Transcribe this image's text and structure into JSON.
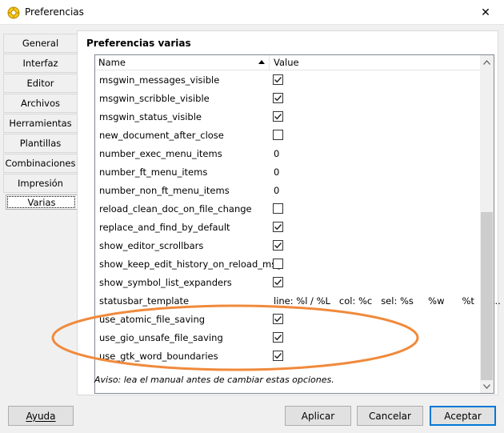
{
  "window": {
    "title": "Preferencias",
    "close_glyph": "✕"
  },
  "tabs": [
    {
      "label": "General",
      "active": false
    },
    {
      "label": "Interfaz",
      "active": false
    },
    {
      "label": "Editor",
      "active": false
    },
    {
      "label": "Archivos",
      "active": false
    },
    {
      "label": "Herramientas",
      "active": false
    },
    {
      "label": "Plantillas",
      "active": false
    },
    {
      "label": "Combinaciones",
      "active": false
    },
    {
      "label": "Impresión",
      "active": false
    },
    {
      "label": "Varias",
      "active": true
    }
  ],
  "panel": {
    "title": "Preferencias varias",
    "columns": {
      "name": "Name",
      "value": "Value"
    },
    "rows": [
      {
        "name": "msgwin_messages_visible",
        "type": "check",
        "checked": true
      },
      {
        "name": "msgwin_scribble_visible",
        "type": "check",
        "checked": true
      },
      {
        "name": "msgwin_status_visible",
        "type": "check",
        "checked": true
      },
      {
        "name": "new_document_after_close",
        "type": "check",
        "checked": false
      },
      {
        "name": "number_exec_menu_items",
        "type": "text",
        "value": "0"
      },
      {
        "name": "number_ft_menu_items",
        "type": "text",
        "value": "0"
      },
      {
        "name": "number_non_ft_menu_items",
        "type": "text",
        "value": "0"
      },
      {
        "name": "reload_clean_doc_on_file_change",
        "type": "check",
        "checked": false
      },
      {
        "name": "replace_and_find_by_default",
        "type": "check",
        "checked": true
      },
      {
        "name": "show_editor_scrollbars",
        "type": "check",
        "checked": true
      },
      {
        "name": "show_keep_edit_history_on_reload_msg",
        "type": "check",
        "checked": false
      },
      {
        "name": "show_symbol_list_expanders",
        "type": "check",
        "checked": true
      },
      {
        "name": "statusbar_template",
        "type": "text",
        "value": "line: %l / %L   col: %c   sel: %s     %w      %t      ..."
      },
      {
        "name": "use_atomic_file_saving",
        "type": "check",
        "checked": true
      },
      {
        "name": "use_gio_unsafe_file_saving",
        "type": "check",
        "checked": true
      },
      {
        "name": "use_gtk_word_boundaries",
        "type": "check",
        "checked": true
      }
    ],
    "note": "Aviso: lea el manual antes de cambiar estas opciones."
  },
  "buttons": {
    "help": "Ayuda",
    "apply": "Aplicar",
    "cancel": "Cancelar",
    "accept": "Aceptar"
  },
  "colors": {
    "annotation": "#f08a3c",
    "default_button_border": "#0078d7"
  }
}
